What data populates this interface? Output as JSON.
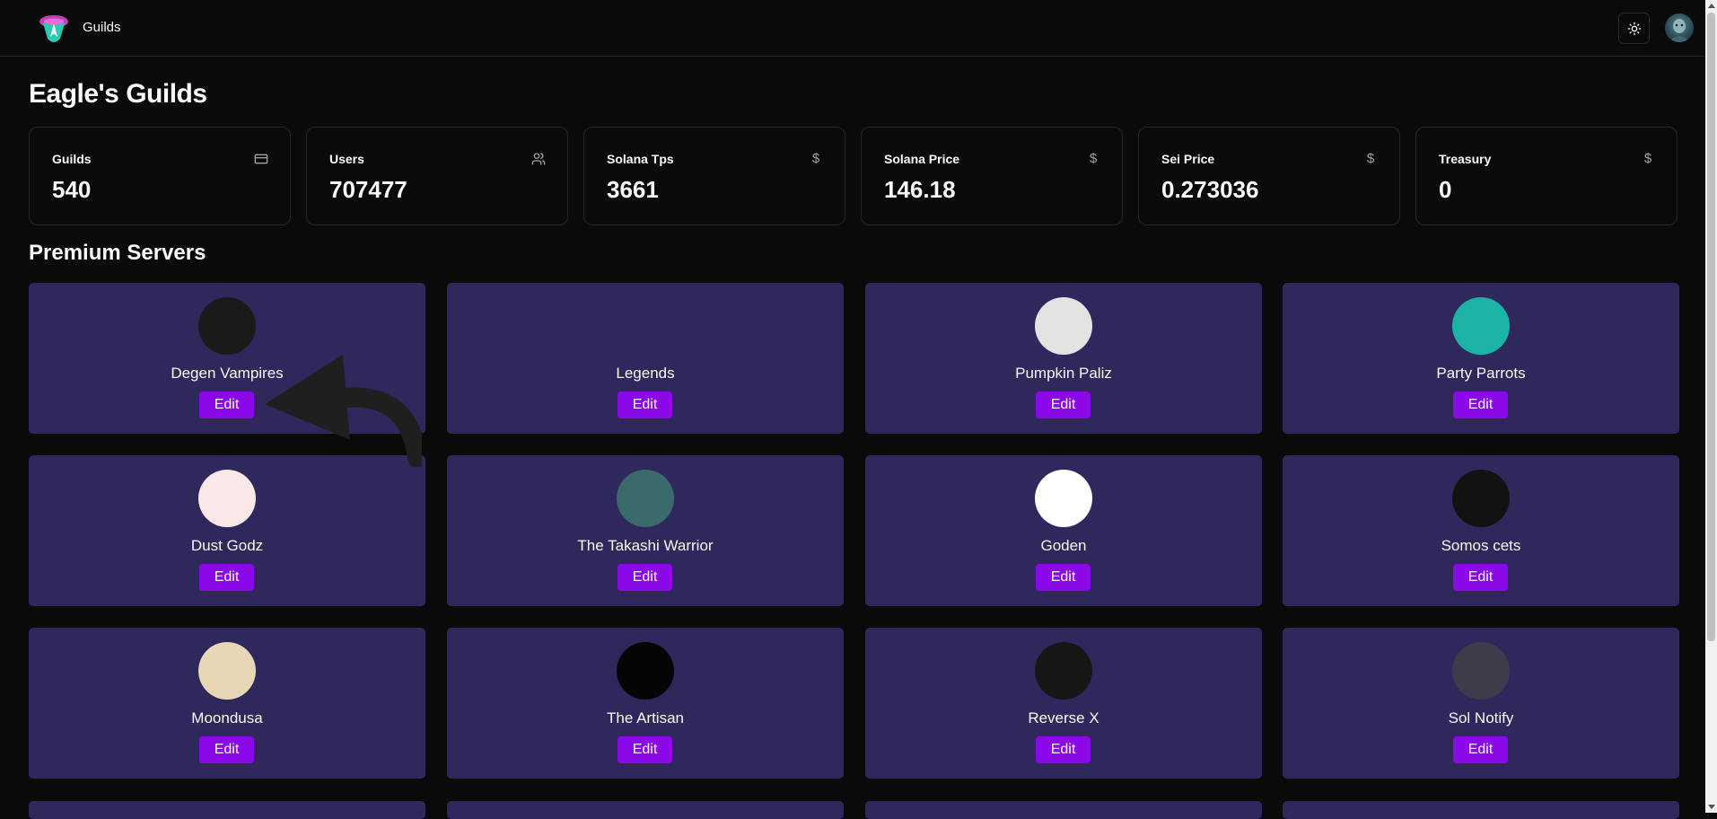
{
  "nav": {
    "link_label": "Guilds",
    "theme_icon": "sun-icon",
    "avatar": "user-avatar"
  },
  "page": {
    "title": "Eagle's Guilds"
  },
  "stats": [
    {
      "label": "Guilds",
      "value": "540",
      "icon": "credit-card-icon"
    },
    {
      "label": "Users",
      "value": "707477",
      "icon": "users-icon"
    },
    {
      "label": "Solana Tps",
      "value": "3661",
      "icon": "dollar-icon"
    },
    {
      "label": "Solana Price",
      "value": "146.18",
      "icon": "dollar-icon"
    },
    {
      "label": "Sei Price",
      "value": "0.273036",
      "icon": "dollar-icon"
    },
    {
      "label": "Treasury",
      "value": "0",
      "icon": "dollar-icon"
    }
  ],
  "section": {
    "title": "Premium Servers"
  },
  "servers": [
    {
      "name": "Degen Vampires",
      "button": "Edit",
      "avatar_color": "#1a1a1a"
    },
    {
      "name": "Legends",
      "button": "Edit",
      "avatar_color": "#2e285c"
    },
    {
      "name": "Pumpkin Paliz",
      "button": "Edit",
      "avatar_color": "#e3e3e3"
    },
    {
      "name": "Party Parrots",
      "button": "Edit",
      "avatar_color": "#1ab3a6"
    },
    {
      "name": "Dust Godz",
      "button": "Edit",
      "avatar_color": "#fbe9ea"
    },
    {
      "name": "The Takashi Warrior",
      "button": "Edit",
      "avatar_color": "#3a6a6c"
    },
    {
      "name": "Goden",
      "button": "Edit",
      "avatar_color": "#ffffff"
    },
    {
      "name": "Somos cets",
      "button": "Edit",
      "avatar_color": "#121212"
    },
    {
      "name": "Moondusa",
      "button": "Edit",
      "avatar_color": "#e7d7b6"
    },
    {
      "name": "The Artisan",
      "button": "Edit",
      "avatar_color": "#050505"
    },
    {
      "name": "Reverse X",
      "button": "Edit",
      "avatar_color": "#161616"
    },
    {
      "name": "Sol Notify",
      "button": "Edit",
      "avatar_color": "#3c3c4a"
    }
  ],
  "colors": {
    "background": "#0b0a0a",
    "card": "#2e285c",
    "button": "#8b08e8",
    "border": "#262626"
  }
}
